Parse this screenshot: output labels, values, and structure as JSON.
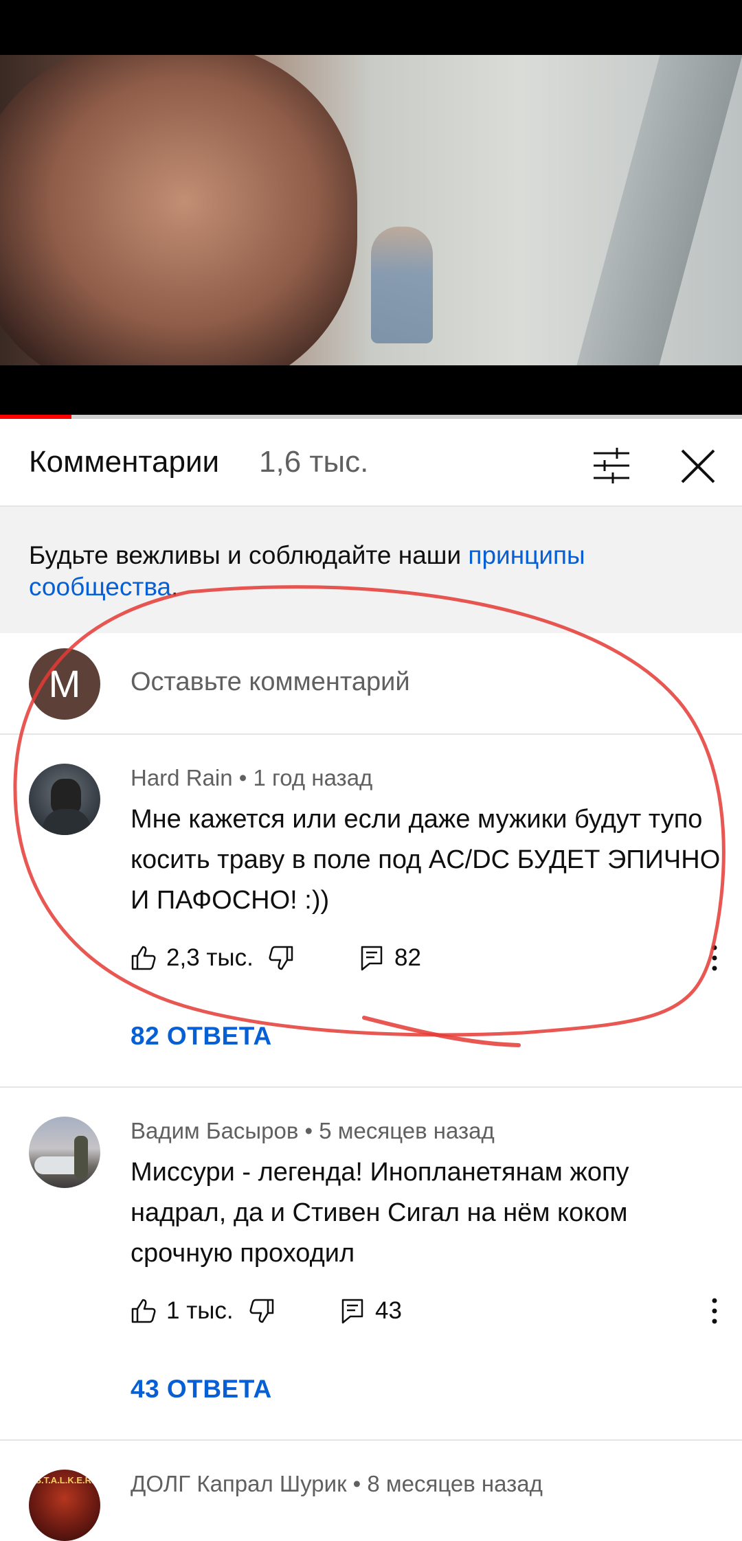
{
  "video": {
    "progress_fraction": 0.096
  },
  "header": {
    "title": "Комментарии",
    "count": "1,6 тыс.",
    "sort_icon": "sort-filter-icon",
    "close_icon": "close-icon"
  },
  "notice": {
    "text_before": "Будьте вежливы и соблюдайте наши ",
    "link": "принципы сообщества",
    "text_after": "."
  },
  "add_comment": {
    "avatar_letter": "M",
    "avatar_color": "#5d4037",
    "placeholder": "Оставьте комментарий"
  },
  "comments": [
    {
      "author": "Hard Rain",
      "time": "1 год назад",
      "text": "Мне кажется или если даже  мужики будут тупо косить траву в поле под  AC/DC БУДЕТ ЭПИЧНО И ПАФОСНО! :))",
      "likes": "2,3 тыс.",
      "reply_count": "82",
      "replies_label": "82 ОТВЕТА"
    },
    {
      "author": "Вадим Басыров",
      "time": "5 месяцев назад",
      "text": "Миссури - легенда! Инопланетянам жопу надрал, да и Стивен Сигал на нём коком срочную проходил",
      "likes": "1 тыс.",
      "reply_count": "43",
      "replies_label": "43 ОТВЕТА"
    },
    {
      "author": "ДОЛГ Капрал Шурик",
      "time": "8 месяцев назад",
      "avatar_text": "S.T.A.L.K.E.R."
    }
  ],
  "meta_separator": " • ",
  "colors": {
    "link": "#065fd4",
    "progress": "#ff0000",
    "annotation": "#e53935"
  }
}
